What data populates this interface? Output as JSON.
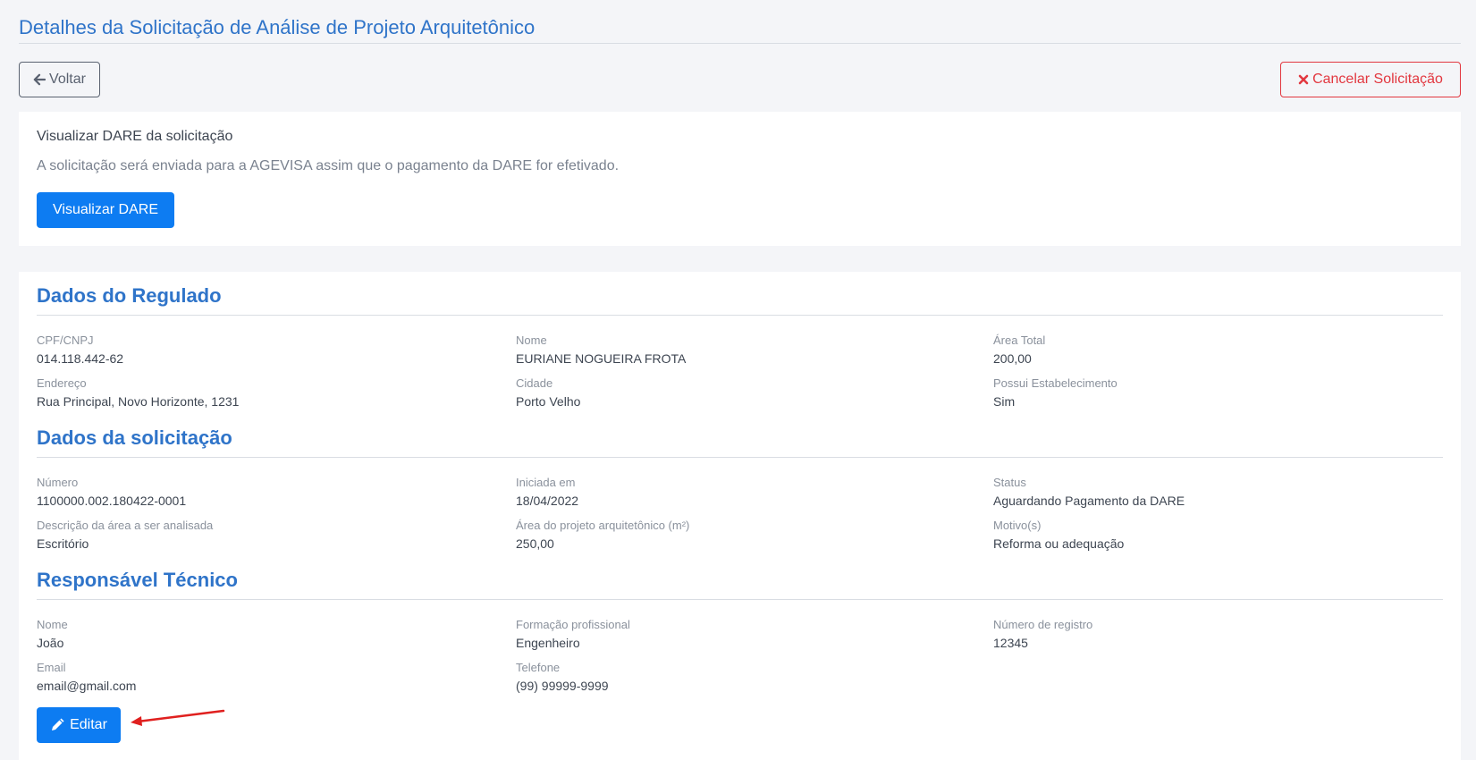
{
  "header": {
    "title": "Detalhes da Solicitação de Análise de Projeto Arquitetônico",
    "back_label": "Voltar",
    "cancel_label": "Cancelar Solicitação"
  },
  "dare": {
    "heading": "Visualizar DARE da solicitação",
    "description": "A solicitação será enviada para a AGEVISA assim que o pagamento da DARE for efetivado.",
    "button_label": "Visualizar DARE"
  },
  "regulado": {
    "title": "Dados do Regulado",
    "fields": [
      {
        "label": "CPF/CNPJ",
        "value": "014.118.442-62"
      },
      {
        "label": "Nome",
        "value": "EURIANE NOGUEIRA FROTA"
      },
      {
        "label": "Área Total",
        "value": "200,00"
      },
      {
        "label": "Endereço",
        "value": "Rua Principal, Novo Horizonte, 1231"
      },
      {
        "label": "Cidade",
        "value": "Porto Velho"
      },
      {
        "label": "Possui Estabelecimento",
        "value": "Sim"
      }
    ]
  },
  "solicitacao": {
    "title": "Dados da solicitação",
    "fields": [
      {
        "label": "Número",
        "value": "1100000.002.180422-0001"
      },
      {
        "label": "Iniciada em",
        "value": "18/04/2022"
      },
      {
        "label": "Status",
        "value": "Aguardando Pagamento da DARE"
      },
      {
        "label": "Descrição da área a ser analisada",
        "value": "Escritório"
      },
      {
        "label": "Área do projeto arquitetônico (m²)",
        "value": "250,00"
      },
      {
        "label": "Motivo(s)",
        "value": "Reforma ou adequação"
      }
    ]
  },
  "responsavel": {
    "title": "Responsável Técnico",
    "fields": [
      {
        "label": "Nome",
        "value": "João"
      },
      {
        "label": "Formação profissional",
        "value": "Engenheiro"
      },
      {
        "label": "Número de registro",
        "value": "12345"
      },
      {
        "label": "Email",
        "value": "email@gmail.com"
      },
      {
        "label": "Telefone",
        "value": "(99) 99999-9999"
      }
    ],
    "edit_label": "Editar"
  },
  "icons": {
    "back": "arrow-left-icon",
    "cancel": "close-icon",
    "edit": "pencil-icon"
  },
  "colors": {
    "accent": "#2f74c9",
    "primary": "#0d7cf2",
    "danger": "#e2373f",
    "annotation": "#e0201f"
  }
}
